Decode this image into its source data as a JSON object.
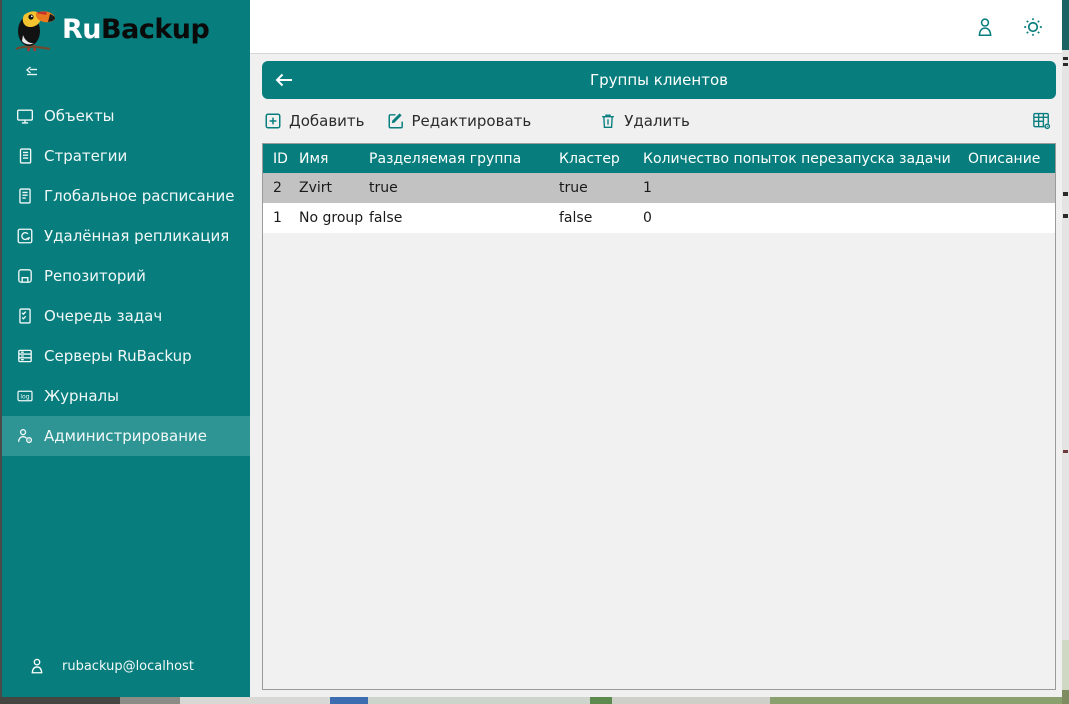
{
  "logo": {
    "text_primary": "Ru",
    "text_secondary": "Backup",
    "icon": "toucan-logo-icon"
  },
  "sidebar": {
    "collapse_icon": "collapse-sidebar-icon",
    "items": [
      {
        "label": "Объекты",
        "icon": "monitor-icon",
        "selected": false
      },
      {
        "label": "Стратегии",
        "icon": "strategies-document-icon",
        "selected": false
      },
      {
        "label": "Глобальное расписание",
        "icon": "schedule-document-icon",
        "selected": false
      },
      {
        "label": "Удалённая репликация",
        "icon": "replication-sync-icon",
        "selected": false
      },
      {
        "label": "Репозиторий",
        "icon": "repository-save-icon",
        "selected": false
      },
      {
        "label": "Очередь задач",
        "icon": "task-queue-checklist-icon",
        "selected": false
      },
      {
        "label": "Серверы RuBackup",
        "icon": "servers-icon",
        "selected": false
      },
      {
        "label": "Журналы",
        "icon": "log-icon",
        "selected": false
      },
      {
        "label": "Администрирование",
        "icon": "admin-user-gear-icon",
        "selected": true
      }
    ],
    "footer": {
      "user": "rubackup@localhost",
      "icon": "user-icon"
    }
  },
  "header": {
    "icons": [
      "user-icon",
      "settings-gear-icon"
    ]
  },
  "panel": {
    "title": "Группы клиентов",
    "back_icon": "back-arrow-icon",
    "toolbar": {
      "add_label": "Добавить",
      "edit_label": "Редактировать",
      "delete_label": "Удалить",
      "columns_icon": "table-column-settings-icon"
    },
    "table": {
      "columns": [
        "ID",
        "Имя",
        "Разделяемая группа",
        "Кластер",
        "Количество попыток перезапуска задачи",
        "Описание"
      ],
      "rows": [
        {
          "cells": [
            "2",
            "Zvirt",
            "true",
            "true",
            "1",
            ""
          ],
          "selected": true
        },
        {
          "cells": [
            "1",
            "No group",
            "false",
            "false",
            "0",
            ""
          ],
          "selected": false
        }
      ]
    }
  },
  "colors": {
    "accent_teal": "#077d7d",
    "sidebar_selected": "#2e9494",
    "selected_row": "#c2c2c2",
    "header_bg": "#ffffff",
    "content_bg": "#f0f0f0"
  }
}
